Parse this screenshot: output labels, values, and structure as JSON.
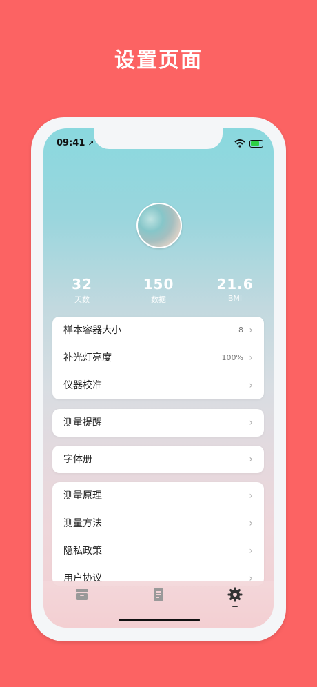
{
  "header": {
    "title": "设置页面"
  },
  "status_bar": {
    "time": "09:41"
  },
  "profile": {
    "stats": [
      {
        "value": "32",
        "label": "天数"
      },
      {
        "value": "150",
        "label": "数据"
      },
      {
        "value": "21.6",
        "label": "BMI"
      }
    ]
  },
  "settings": {
    "group1": [
      {
        "label": "样本容器大小",
        "value": "8"
      },
      {
        "label": "补光灯亮度",
        "value": "100%"
      },
      {
        "label": "仪器校准",
        "value": ""
      }
    ],
    "group2": [
      {
        "label": "测量提醒"
      }
    ],
    "group3": [
      {
        "label": "字体册"
      }
    ],
    "group4": [
      {
        "label": "测量原理"
      },
      {
        "label": "测量方法"
      },
      {
        "label": "隐私政策"
      },
      {
        "label": "用户协议"
      }
    ]
  },
  "tabbar": {
    "tabs": [
      {
        "icon": "archive-icon",
        "active": false
      },
      {
        "icon": "document-icon",
        "active": false
      },
      {
        "icon": "gear-icon",
        "active": true
      }
    ]
  },
  "colors": {
    "background": "#fc6363",
    "accent_teal": "#8ad8de",
    "battery": "#2fcf45"
  }
}
